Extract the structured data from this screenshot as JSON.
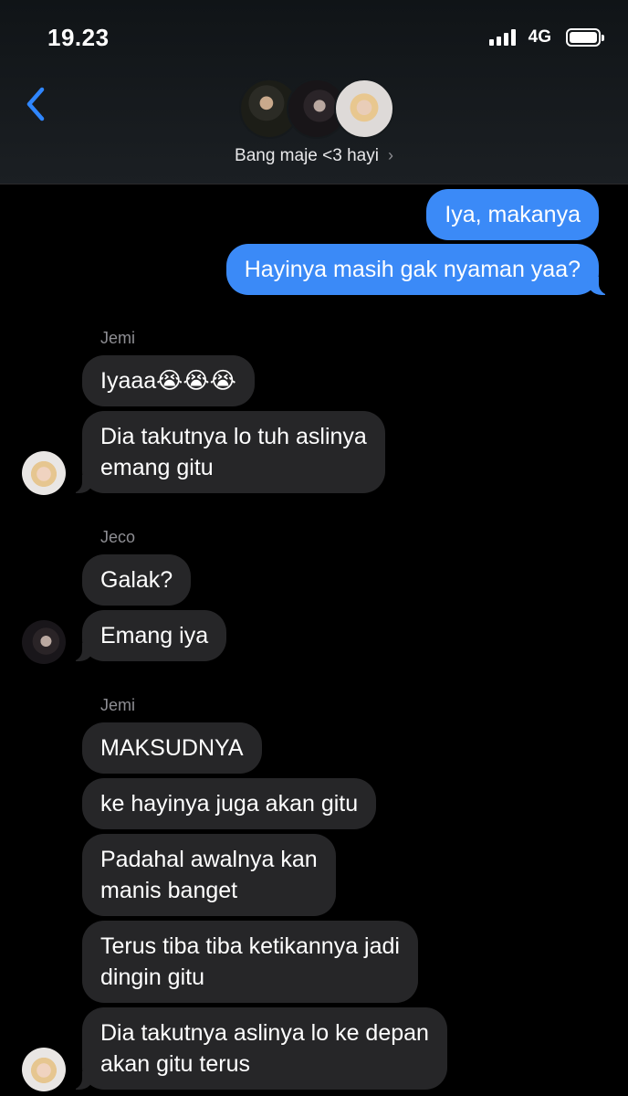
{
  "status_bar": {
    "time": "19.23",
    "network": "4G"
  },
  "header": {
    "chat_name": "Bang maje <3 hayi",
    "chevron": "›"
  },
  "messages": {
    "m1": "Iya, makanya",
    "m2": "Hayinya masih gak nyaman yaa?",
    "s1": "Jemi",
    "m3": "Iyaaa😭😭😭",
    "m4a": "Dia takutnya lo tuh aslinya",
    "m4b": "emang gitu",
    "s2": "Jeco",
    "m5": "Galak?",
    "m6": "Emang iya",
    "s3": "Jemi",
    "m7": "MAKSUDNYA",
    "m8": "ke hayinya juga akan gitu",
    "m9a": "Padahal awalnya kan",
    "m9b": "manis banget",
    "m10a": "Terus tiba tiba ketikannya jadi",
    "m10b": "dingin gitu",
    "m11a": "Dia takutnya aslinya lo ke depan",
    "m11b": "akan gitu terus"
  },
  "colors": {
    "sent_bubble": "#3b8af7",
    "received_bubble": "#262628",
    "sender_label": "#8e8e93"
  },
  "icons": {
    "back": "chevron-left-icon",
    "signal": "signal-bars-icon",
    "battery": "battery-icon"
  }
}
